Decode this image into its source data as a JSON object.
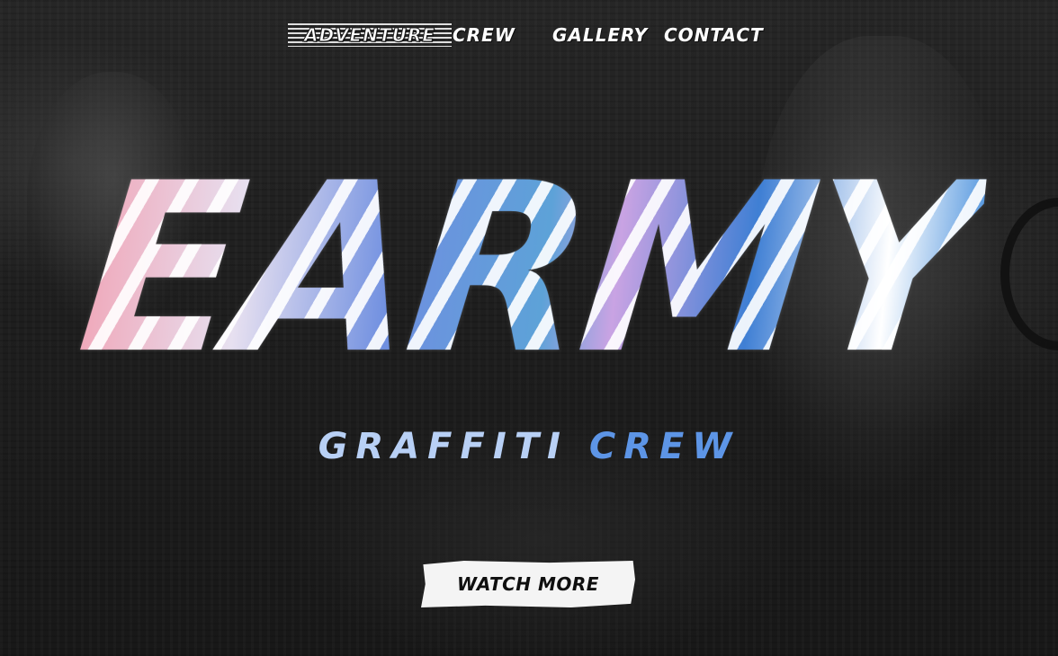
{
  "nav": {
    "items": [
      {
        "label": "Adventure",
        "active": true
      },
      {
        "label": "Crew",
        "active": false
      },
      {
        "label": "Gallery",
        "active": false
      },
      {
        "label": "Contact",
        "active": false
      }
    ]
  },
  "hero": {
    "title": "EARMY",
    "subtitle_part1": "Graffiti",
    "subtitle_part2": "Crew"
  },
  "cta": {
    "label": "Watch more"
  },
  "colors": {
    "background": "#1b1b1b",
    "accent_light_blue": "#b8d0f5",
    "accent_blue": "#5d95e6",
    "accent_pink": "#f0a5b7",
    "button_bg": "#f4f4f4",
    "button_text": "#0f0f0f"
  }
}
